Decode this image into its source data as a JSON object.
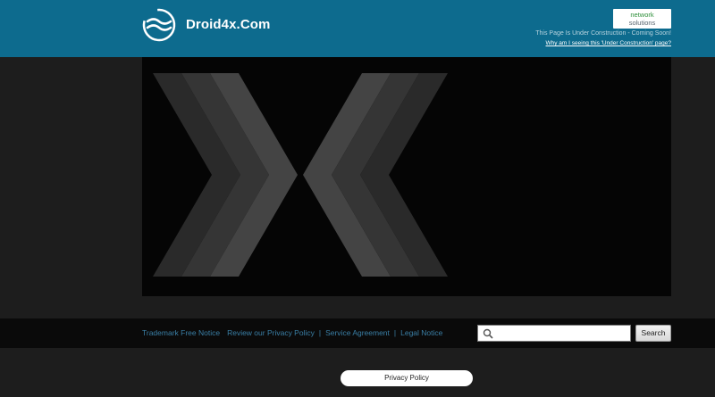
{
  "header": {
    "site_title": "Droid4x.Com",
    "badge_line1": "network",
    "badge_line2": "solutions",
    "under_construction": "This Page Is Under Construction - Coming Soon!",
    "why_link": "Why am I seeing this 'Under Construction' page?"
  },
  "footer": {
    "links": [
      "Trademark Free Notice",
      "Review our Privacy Policy",
      "Service Agreement",
      "Legal Notice"
    ],
    "search_placeholder": "",
    "search_button": "Search",
    "privacy_button": "Privacy Policy"
  },
  "colors": {
    "header_bg": "#0d6b8e",
    "page_bg": "#1d1d1d",
    "link": "#3a7fa6"
  }
}
